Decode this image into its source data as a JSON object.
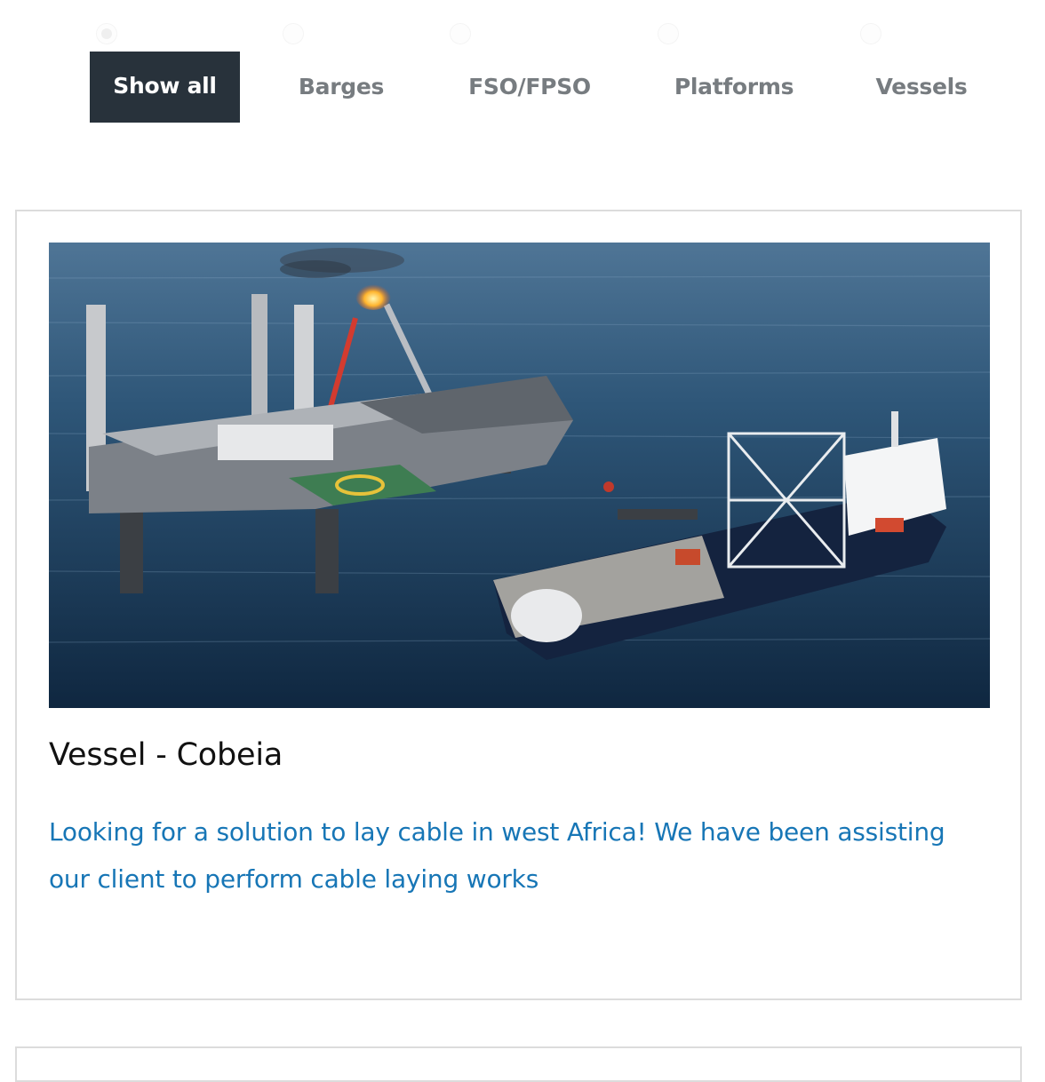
{
  "filters": {
    "items": [
      {
        "label": "Show all",
        "active": true
      },
      {
        "label": "Barges",
        "active": false
      },
      {
        "label": "FSO/FPSO",
        "active": false
      },
      {
        "label": "Platforms",
        "active": false
      },
      {
        "label": "Vessels",
        "active": false
      }
    ],
    "active_bg": "#28323b",
    "inactive_color": "#777c80"
  },
  "card": {
    "image": {
      "icon": "offshore-platform-and-cable-laying-vessel-photo"
    },
    "title": "Vessel - Cobeia",
    "description": "Looking for a solution to lay cable in west Africa! We have been assisting our client to perform cable laying works",
    "description_color": "#1776b6"
  }
}
